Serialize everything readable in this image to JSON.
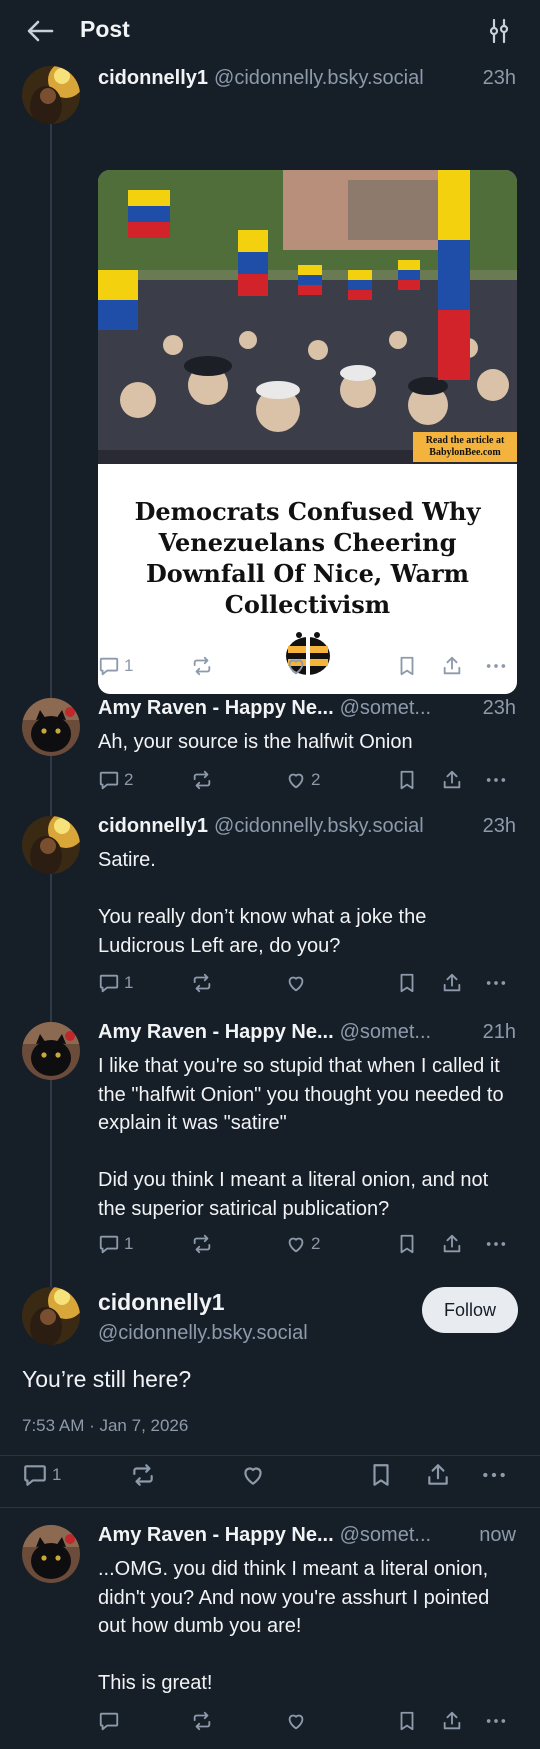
{
  "header": {
    "title": "Post",
    "back_icon": "arrow-left-icon",
    "settings_icon": "sliders-icon"
  },
  "posts": [
    {
      "name": "cidonnelly1",
      "handle": "@cidonnelly.bsky.social",
      "time": "23h",
      "text": "",
      "card": {
        "title": "Democrats Confused Why Venezuelans Cheering Downfall Of Nice, Warm Collectivism",
        "badge_line1": "Read the article at",
        "badge_line2": "BabylonBee.com"
      },
      "replies": "1",
      "reposts": "",
      "likes": ""
    },
    {
      "name": "Amy Raven - Happy Ne...",
      "handle": "@somet...",
      "time": "23h",
      "text": "Ah, your source is the halfwit Onion",
      "replies": "2",
      "reposts": "",
      "likes": "2"
    },
    {
      "name": "cidonnelly1",
      "handle": "@cidonnelly.bsky.social",
      "time": "23h",
      "text": "Satire.\n\nYou really don’t know what a joke the Ludicrous Left are, do you?",
      "replies": "1",
      "reposts": "",
      "likes": ""
    },
    {
      "name": "Amy Raven - Happy Ne...",
      "handle": "@somet...",
      "time": "21h",
      "text": "I like that you're so stupid that when I called it the \"halfwit Onion\" you thought you needed to explain it was \"satire\"\n\nDid you think I meant a literal onion, and not the superior satirical publication?",
      "replies": "1",
      "reposts": "",
      "likes": "2"
    }
  ],
  "focused": {
    "name": "cidonnelly1",
    "handle": "@cidonnelly.bsky.social",
    "follow_label": "Follow",
    "text": "You’re still here?",
    "timestamp": "7:53 AM · Jan 7, 2026",
    "replies": "1",
    "reposts": "",
    "likes": ""
  },
  "reply": {
    "name": "Amy Raven - Happy Ne...",
    "handle": "@somet...",
    "time": "now",
    "text": "...OMG. you did think I meant a literal onion, didn't you? And now you're asshurt I pointed out how dumb you are!\n\nThis is great!",
    "replies": "",
    "reposts": "",
    "likes": ""
  },
  "colors": {
    "background": "#161e27",
    "muted": "#8d9aab",
    "text": "#f1f3f5",
    "thread": "#2e3a48"
  },
  "icons": [
    "reply-icon",
    "repost-icon",
    "like-icon",
    "bookmark-icon",
    "share-icon",
    "more-icon"
  ]
}
